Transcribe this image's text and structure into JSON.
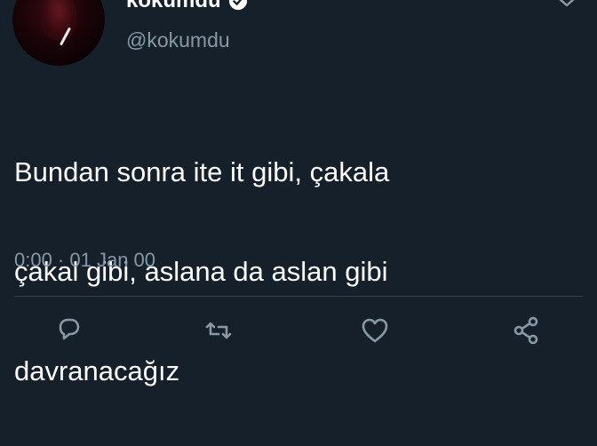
{
  "user": {
    "display_name": "kokumdu",
    "handle": "@kokumdu"
  },
  "tweet": {
    "text_lines": [
      "Bundan sonra ite it gibi, çakala",
      "çakal gibi, aslana da aslan gibi",
      "davranacağız"
    ],
    "timestamp": "0:00 · 01 Jan 00"
  },
  "actions": [
    {
      "icon": "reply-icon"
    },
    {
      "icon": "retweet-icon"
    },
    {
      "icon": "like-icon"
    },
    {
      "icon": "share-icon"
    }
  ],
  "colors": {
    "background": "#15202b",
    "text": "#ffffff",
    "secondary_text": "#8899a6",
    "divider": "#38444d"
  }
}
